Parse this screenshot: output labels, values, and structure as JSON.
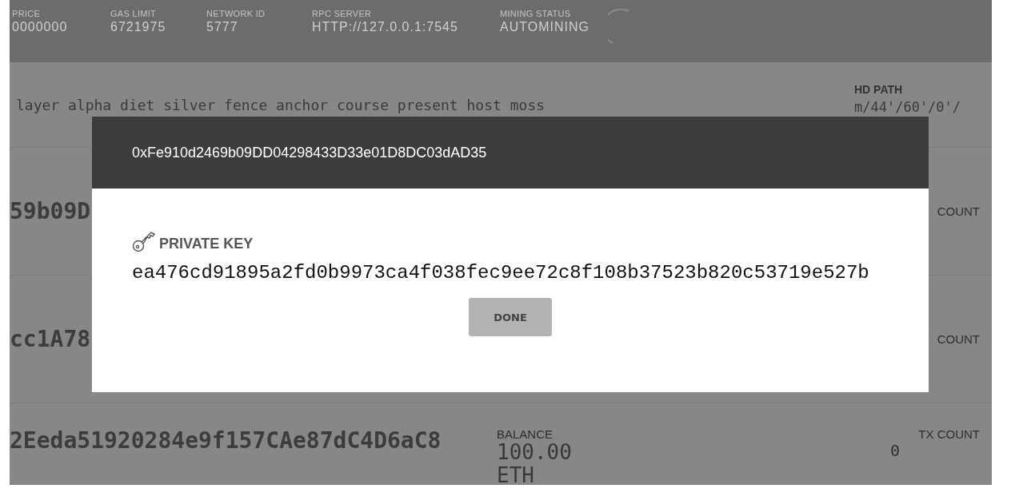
{
  "header": {
    "stats": [
      {
        "label": "PRICE",
        "value": "0000000"
      },
      {
        "label": "GAS LIMIT",
        "value": "6721975"
      },
      {
        "label": "NETWORK ID",
        "value": "5777"
      },
      {
        "label": "RPC SERVER",
        "value": "HTTP://127.0.0.1:7545"
      },
      {
        "label": "MINING STATUS",
        "value": "AUTOMINING"
      }
    ]
  },
  "mnemonic": {
    "text": "layer alpha diet silver fence anchor course present host moss",
    "hd_path_label": "HD PATH",
    "hd_path": "m/44'/60'/0'/"
  },
  "accounts": [
    {
      "address": "59b09D",
      "tx_count_label": "COUNT"
    },
    {
      "address": "cc1A78",
      "tx_count_label": "COUNT"
    },
    {
      "address": "2Eeda51920284e9f157CAe87dC4D6aC8",
      "balance_label": "BALANCE",
      "balance": "100.00 ETH",
      "tx_count_label": "TX COUNT",
      "tx_count": "0"
    }
  ],
  "modal": {
    "title": "0xFe910d2469b09DD04298433D33e01D8DC03dAD35",
    "section_label": "PRIVATE KEY",
    "private_key": "ea476cd91895a2fd0b9973ca4f038fec9ee72c8f108b37523b820c53719e527b",
    "button": "DONE"
  }
}
